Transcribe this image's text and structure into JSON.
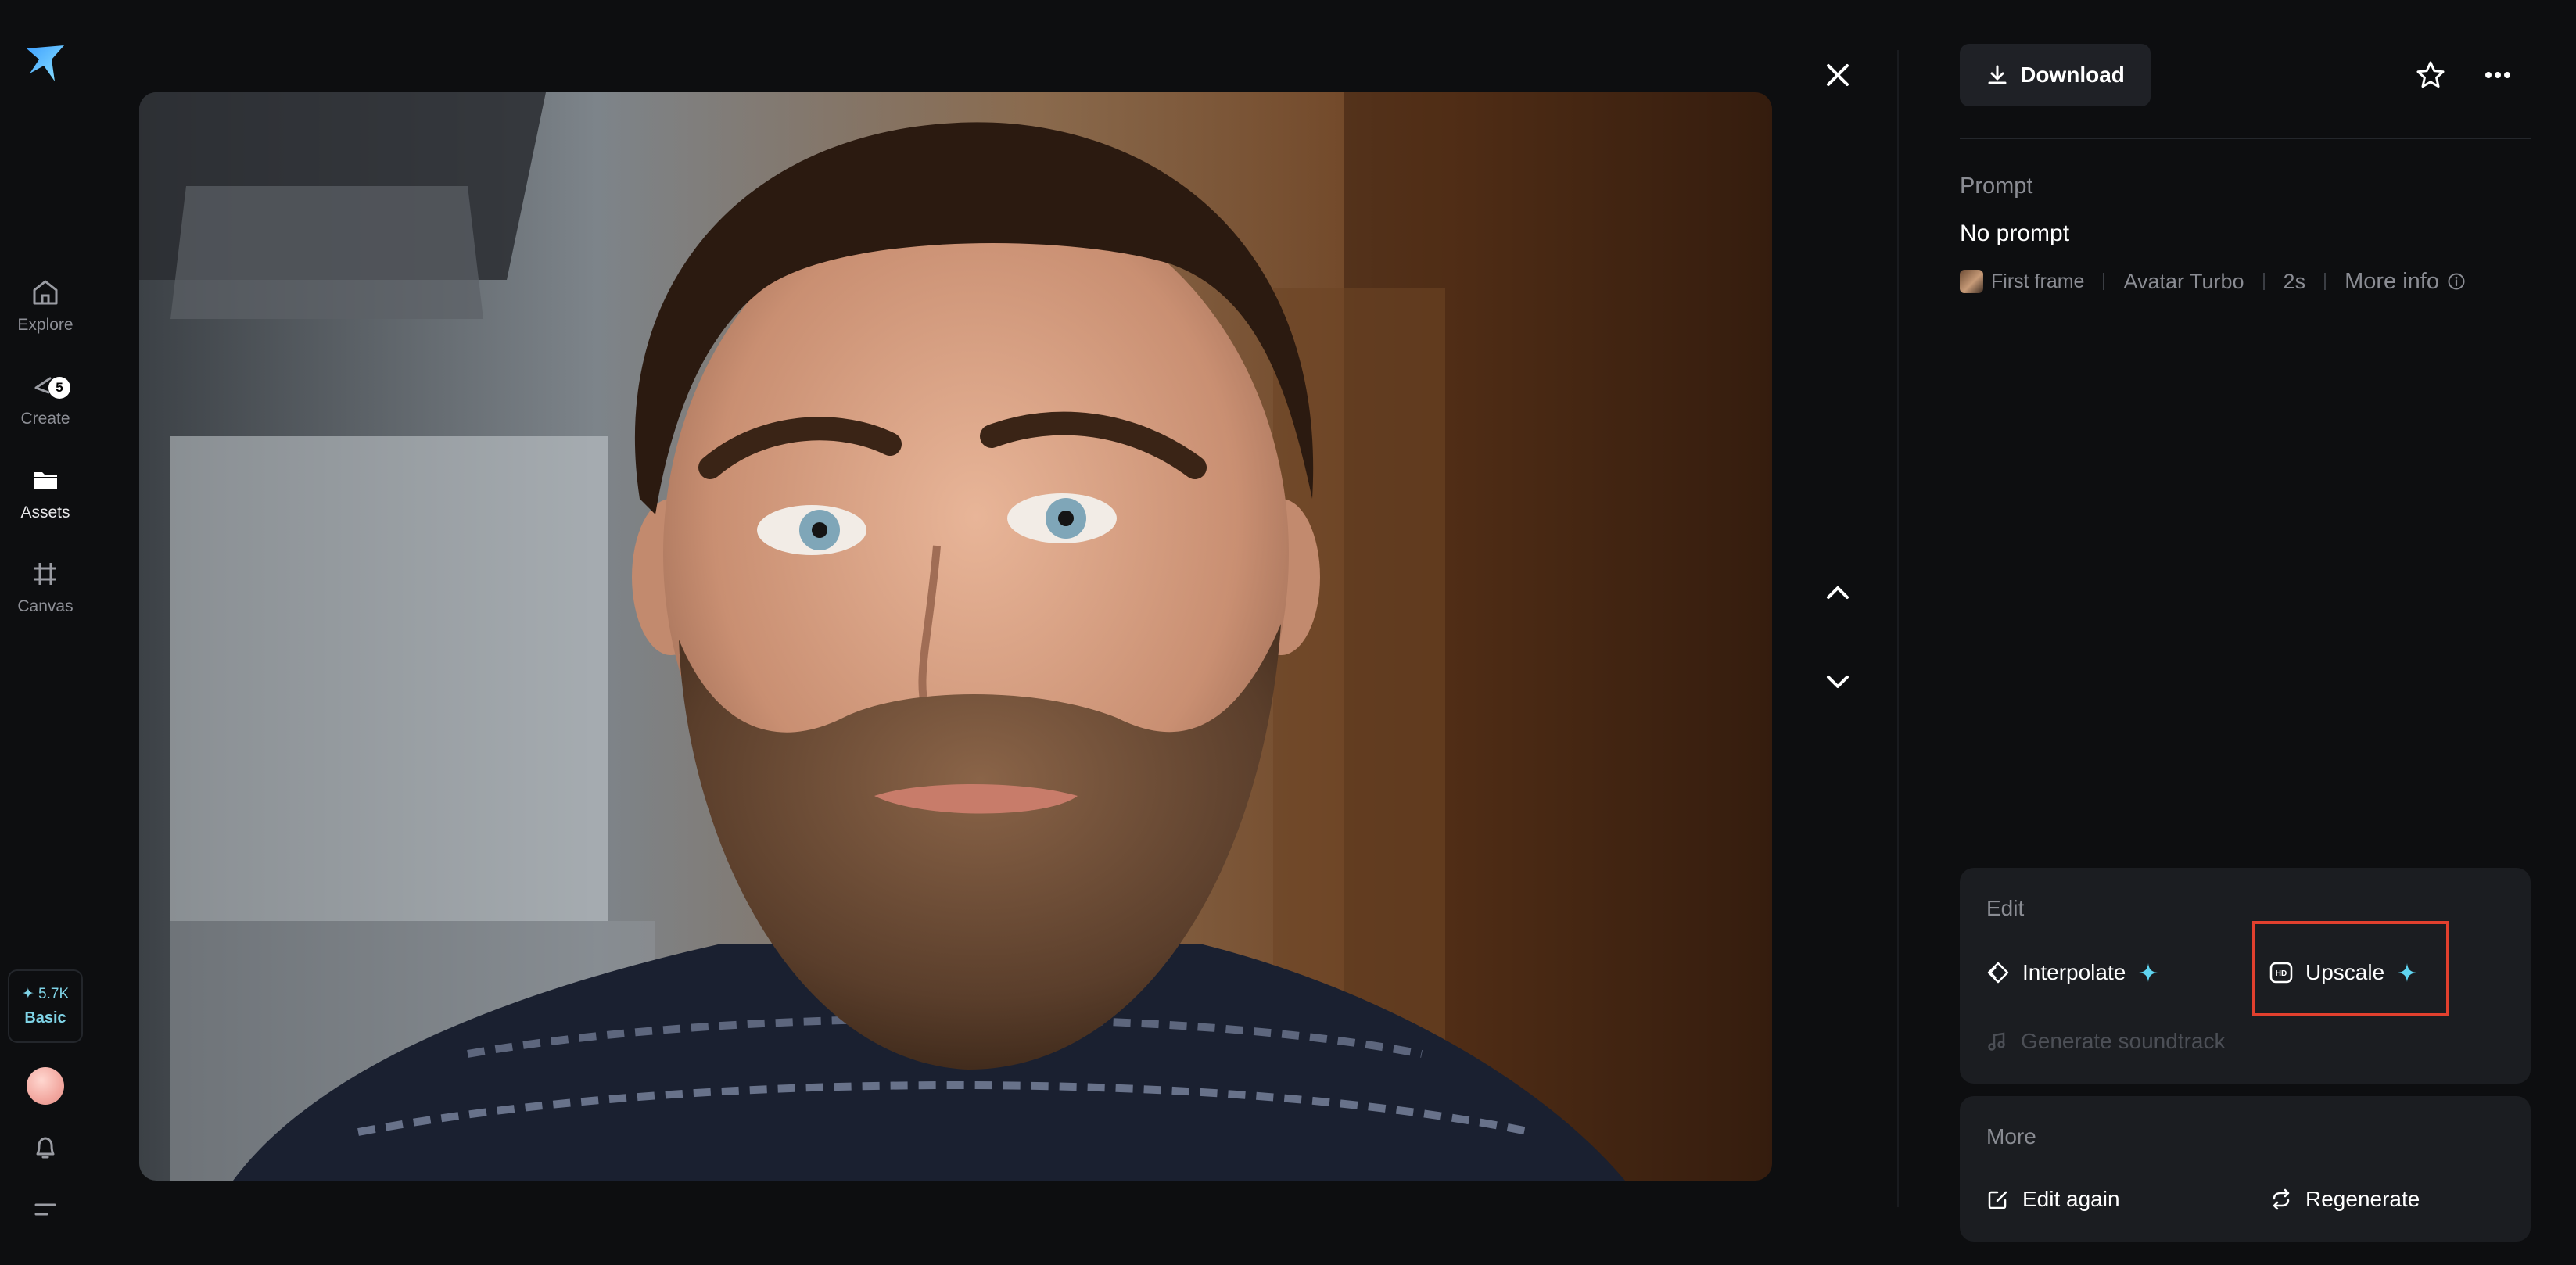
{
  "nav": {
    "items": [
      {
        "label": "Explore"
      },
      {
        "label": "Create",
        "badge": "5"
      },
      {
        "label": "Assets"
      },
      {
        "label": "Canvas"
      }
    ],
    "credits": {
      "value": "✦ 5.7K",
      "plan": "Basic"
    }
  },
  "toolbar": {
    "download_label": "Download"
  },
  "prompt": {
    "heading": "Prompt",
    "value": "No prompt",
    "first_frame": "First frame",
    "model": "Avatar Turbo",
    "duration": "2s",
    "more_info": "More info"
  },
  "edit": {
    "title": "Edit",
    "interpolate": "Interpolate",
    "upscale": "Upscale",
    "soundtrack": "Generate soundtrack"
  },
  "more": {
    "title": "More",
    "edit_again": "Edit again",
    "regenerate": "Regenerate"
  },
  "colors": {
    "accent": "#5fd4f0",
    "highlight": "#e2402e",
    "background": "#0d0e10",
    "card": "#1b1d21"
  }
}
